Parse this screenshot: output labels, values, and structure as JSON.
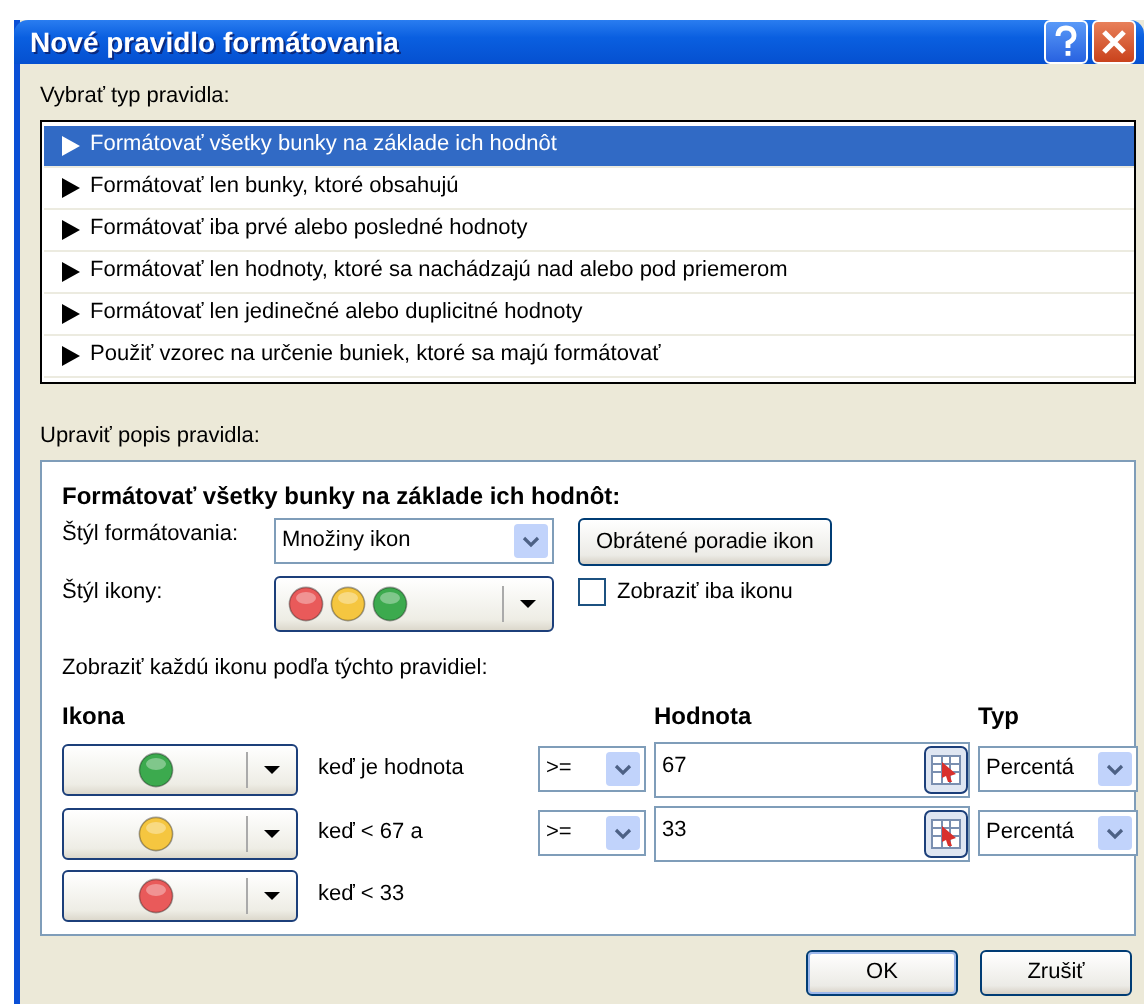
{
  "window": {
    "title": "Nové pravidlo formátovania"
  },
  "rule_type": {
    "label": "Vybrať typ pravidla:",
    "items": [
      {
        "label": "Formátovať všetky bunky na základe ich hodnôt",
        "selected": true
      },
      {
        "label": "Formátovať len bunky, ktoré obsahujú",
        "selected": false
      },
      {
        "label": "Formátovať iba prvé alebo posledné hodnoty",
        "selected": false
      },
      {
        "label": "Formátovať len hodnoty, ktoré sa nachádzajú nad alebo pod priemerom",
        "selected": false
      },
      {
        "label": "Formátovať len jedinečné alebo duplicitné hodnoty",
        "selected": false
      },
      {
        "label": "Použiť vzorec na určenie buniek, ktoré sa majú formátovať",
        "selected": false
      }
    ]
  },
  "description": {
    "label": "Upraviť popis pravidla:",
    "heading": "Formátovať všetky bunky na základe ich hodnôt:",
    "format_style": {
      "label": "Štýl formátovania:",
      "value": "Množiny ikon"
    },
    "reverse_button": "Obrátené poradie ikon",
    "icon_style": {
      "label": "Štýl ikony:",
      "icons": [
        {
          "color": "#e95a5a"
        },
        {
          "color": "#f5c640"
        },
        {
          "color": "#3caa4e"
        }
      ]
    },
    "show_icon_only": {
      "label": "Zobraziť iba ikonu",
      "checked": false
    },
    "rules_caption": "Zobraziť každú ikonu podľa týchto pravidiel:",
    "columns": {
      "icon": "Ikona",
      "value": "Hodnota",
      "type": "Typ"
    },
    "rules": [
      {
        "color": "#3caa4e",
        "condition": "keď je hodnota",
        "operator": ">=",
        "value": "67",
        "type": "Percentá"
      },
      {
        "color": "#f5c640",
        "condition": "keď < 67 a",
        "operator": ">=",
        "value": "33",
        "type": "Percentá"
      },
      {
        "color": "#e95a5a",
        "condition": "keď < 33"
      }
    ]
  },
  "buttons": [
    {
      "label": "OK",
      "default": true
    },
    {
      "label": "Zrušiť",
      "default": false
    }
  ]
}
